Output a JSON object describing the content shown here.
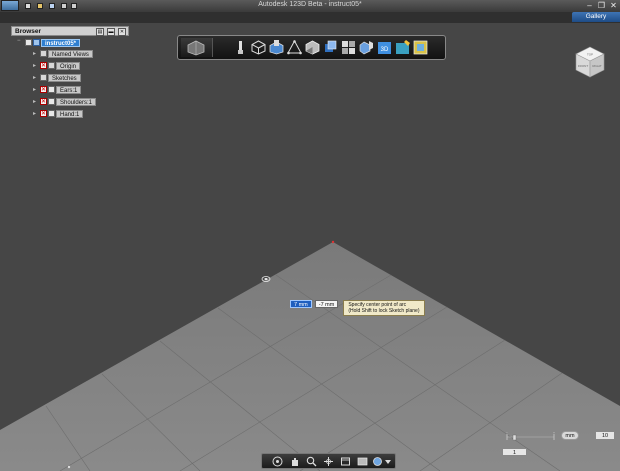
{
  "window": {
    "title": "Autodesk 123D Beta - instruct05*",
    "gallery_label": "Gallery"
  },
  "browser": {
    "title": "Browser",
    "root": "instruct05*",
    "items": [
      {
        "label": "Named Views",
        "icon": "folder-icon"
      },
      {
        "label": "Origin",
        "icon": "hidden-icon"
      },
      {
        "label": "Sketches",
        "icon": "folder-icon"
      },
      {
        "label": "Ears:1",
        "icon": "hidden-icon"
      },
      {
        "label": "Shoulders:1",
        "icon": "hidden-icon"
      },
      {
        "label": "Hand:1",
        "icon": "hidden-icon"
      }
    ]
  },
  "viewcube": {
    "top": "TOP",
    "front": "FRONT",
    "right": "RIGHT"
  },
  "sketch_input": {
    "x_value": "7 mm",
    "y_value": "-7 mm",
    "tooltip_line1": "Specify center point of arc",
    "tooltip_line2": "(Hold Shift to lock Sketch plane)"
  },
  "grid_controls": {
    "units": "mm",
    "grid_size": "10",
    "small_value": "1"
  },
  "colors": {
    "background": "#464646",
    "ground": "#7f7f7f",
    "accent": "#2f7fd0",
    "tooltip": "#f0e9c8"
  }
}
